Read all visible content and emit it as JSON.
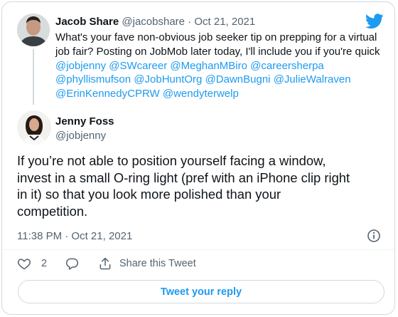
{
  "colors": {
    "link": "#1d9bf0",
    "muted": "#536471",
    "border": "#cfd9de",
    "text": "#0f1419"
  },
  "reply_to_tweet": {
    "author_name": "Jacob Share",
    "author_handle": "@jacobshare",
    "separator": " · ",
    "date": "Oct 21, 2021",
    "text_lines": [
      "What's your fave non-obvious job seeker tip on prepping for a virtual",
      "job fair? Posting on JobMob later today, I'll include you if you're quick"
    ],
    "mention_lines": [
      [
        "@jobjenny",
        "@SWcareer",
        "@MeghanMBiro",
        "@careersherpa"
      ],
      [
        "@phyllismufson",
        "@JobHuntOrg",
        "@DawnBugni",
        "@JulieWalraven"
      ],
      [
        "@ErinKennedyCPRW",
        "@wendyterwelp"
      ]
    ],
    "avatar_icon": "person-photo"
  },
  "main_tweet": {
    "author_name": "Jenny Foss",
    "author_handle": "@jobjenny",
    "text_lines": [
      "If you’re not able to position yourself facing a window,",
      "invest in a small O-ring light (pref with an iPhone clip right",
      "in it) so that you look more polished than your",
      "competition."
    ],
    "timestamp": "11:38 PM · Oct 21, 2021",
    "avatar_icon": "person-photo"
  },
  "actions": {
    "like_icon": "heart-icon",
    "like_count": "2",
    "reply_icon": "comment-icon",
    "share_icon": "share-icon",
    "share_label": "Share this Tweet"
  },
  "reply_button_label": "Tweet your reply",
  "brand_icon": "twitter-bird-icon",
  "info_icon": "info-icon"
}
